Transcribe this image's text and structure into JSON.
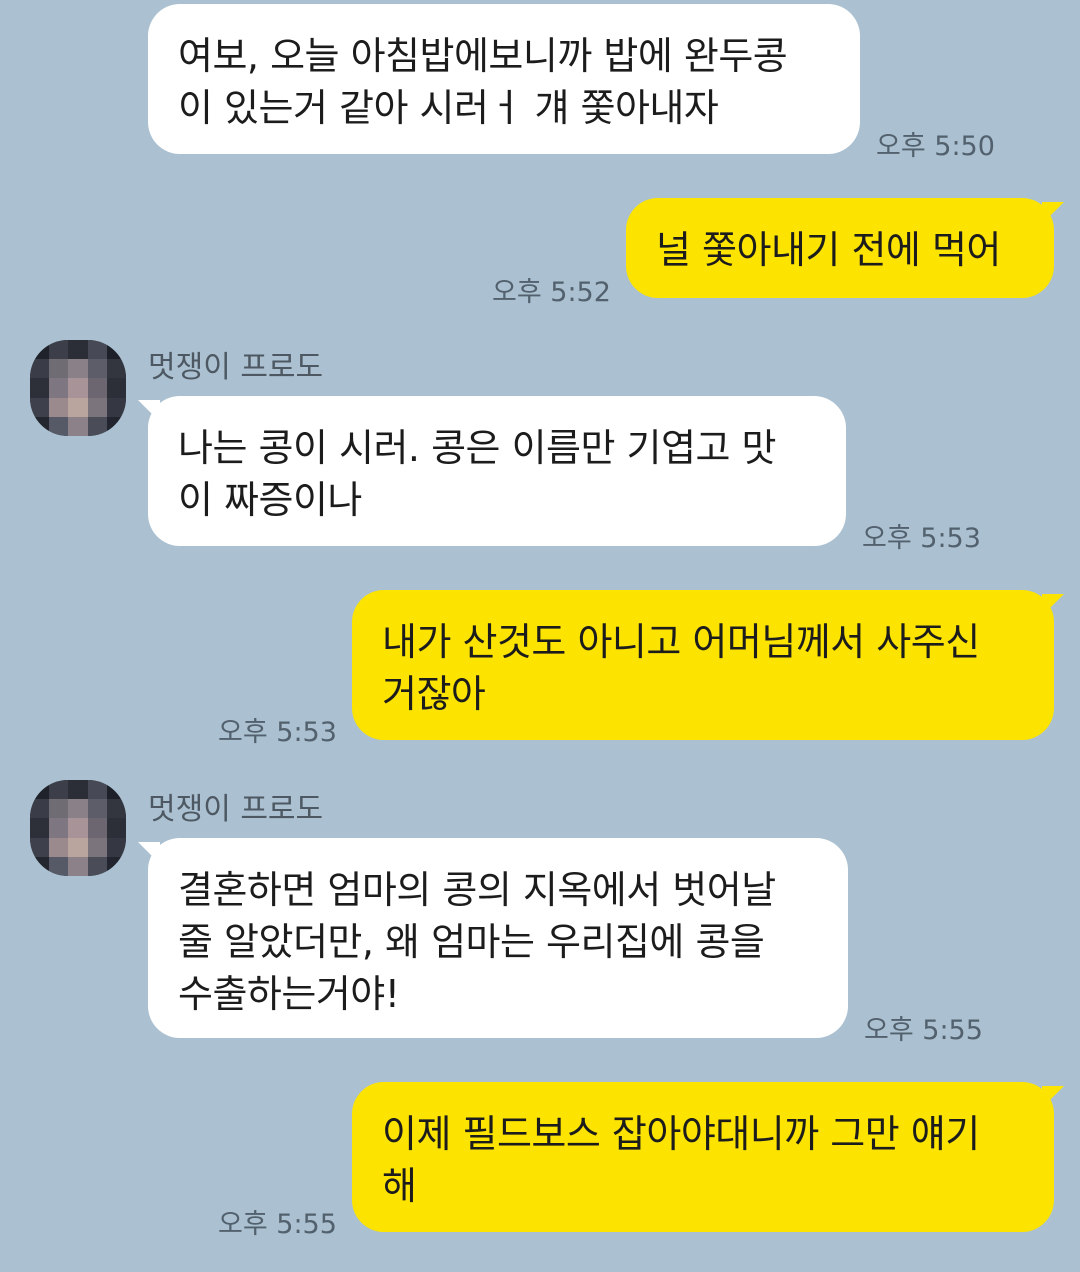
{
  "colors": {
    "background": "#abc1d1",
    "incoming_bubble": "#ffffff",
    "outgoing_bubble": "#fce300",
    "timestamp_text": "#52616d"
  },
  "messages": [
    {
      "direction": "in",
      "sender": "",
      "text": "여보, 오늘 아침밥에보니까 밥에 완두콩\n이 있는거 같아 시러ㅓ 걔 쫓아내자",
      "time": "오후 5:50"
    },
    {
      "direction": "out",
      "text": "널 쫓아내기 전에 먹어",
      "time": "오후 5:52"
    },
    {
      "direction": "in",
      "sender": "멋쟁이 프로도",
      "avatar": "blurred-profile-photo",
      "text": "나는 콩이 시러. 콩은 이름만 기엽고 맛\n이 짜증이나",
      "time": "오후 5:53"
    },
    {
      "direction": "out",
      "text": "내가 산것도 아니고 어머님께서 사주신\n거잖아",
      "time": "오후 5:53"
    },
    {
      "direction": "in",
      "sender": "멋쟁이 프로도",
      "avatar": "blurred-profile-photo",
      "text": "결혼하면 엄마의 콩의 지옥에서 벗어날\n줄 알았더만, 왜 엄마는 우리집에 콩을\n수출하는거야!",
      "time": "오후 5:55"
    },
    {
      "direction": "out",
      "text": "이제 필드보스 잡아야대니까 그만 얘기\n해",
      "time": "오후 5:55"
    }
  ]
}
